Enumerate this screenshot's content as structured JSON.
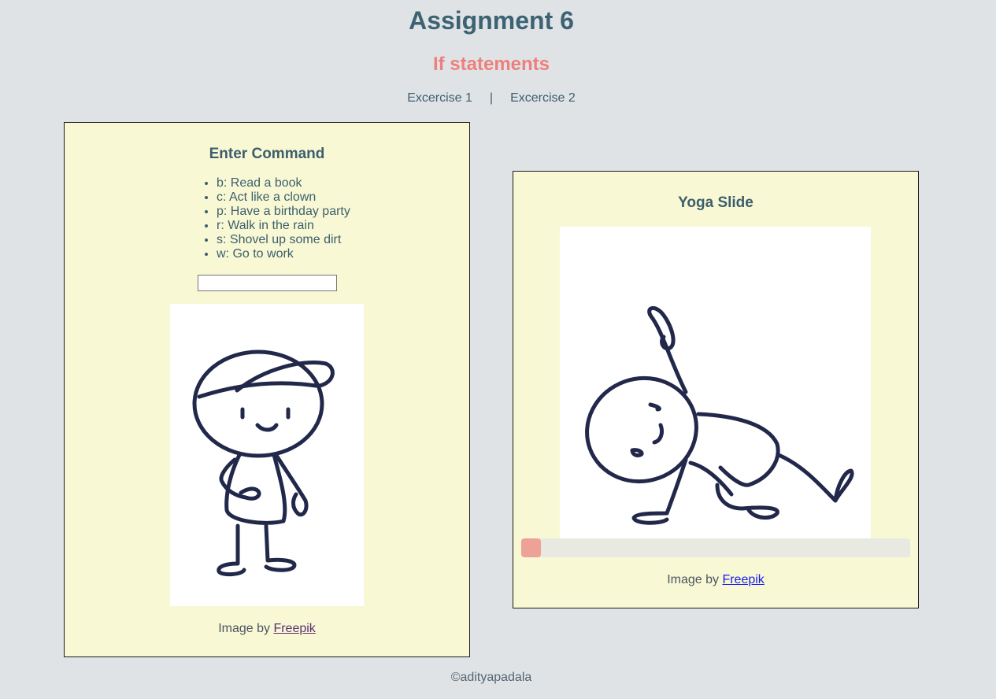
{
  "header": {
    "title": "Assignment 6",
    "subtitle": "If statements"
  },
  "nav": {
    "items": [
      {
        "label": "Excercise 1"
      },
      {
        "label": "Excercise 2"
      }
    ],
    "separator": "|"
  },
  "command_panel": {
    "heading": "Enter Command",
    "commands": [
      "b: Read a book",
      "c: Act like a clown",
      "p: Have a birthday party",
      "r: Walk in the rain",
      "s: Shovel up some dirt",
      "w: Go to work"
    ],
    "input": {
      "value": "",
      "placeholder": ""
    },
    "credit_prefix": "Image by",
    "credit_link": "Freepik"
  },
  "yoga_panel": {
    "heading": "Yoga Slide",
    "slider": {
      "value": 0,
      "min": 0,
      "max": 100
    },
    "credit_prefix": "Image by",
    "credit_link": "Freepik"
  },
  "footer": {
    "text": "©adityapadala"
  },
  "colors": {
    "background": "#dfe3e6",
    "panel": "#f8f9d4",
    "title": "#3d6272",
    "subtitle": "#ef7f7c",
    "slider_thumb": "#eea196",
    "slider_track": "#e8e9e1",
    "drawing_stroke": "#22284a"
  },
  "icons": {
    "left_image": "stick-figure-cap-illustration",
    "right_image": "stick-figure-yoga-pose-illustration"
  }
}
